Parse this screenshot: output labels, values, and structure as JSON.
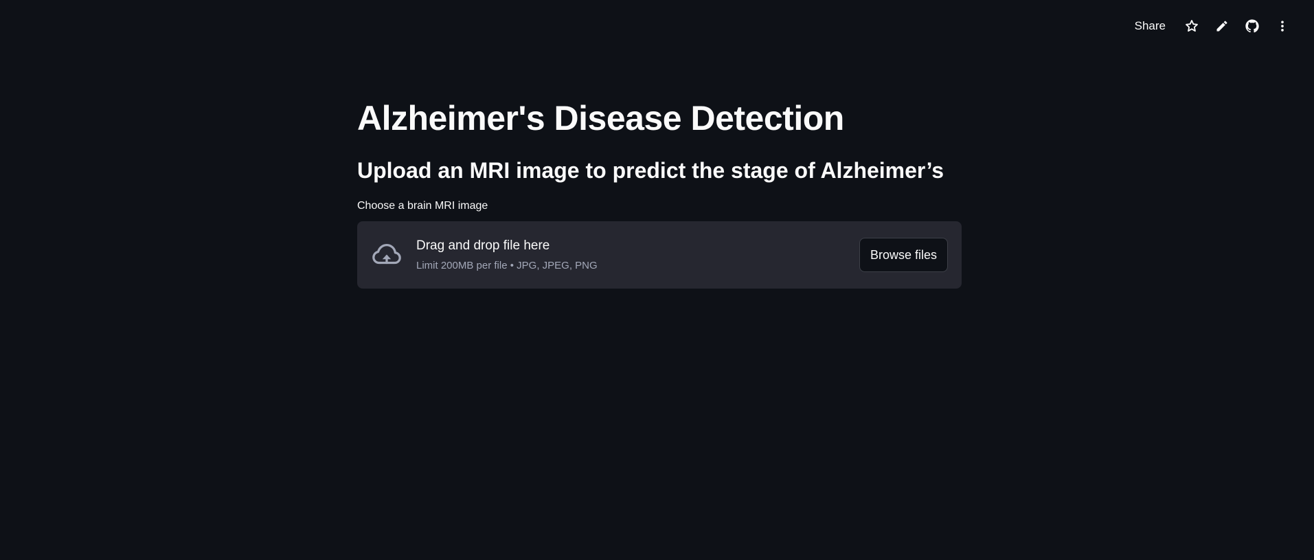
{
  "toolbar": {
    "share_label": "Share",
    "icons": [
      "star-icon",
      "pencil-icon",
      "github-icon",
      "more-vertical-icon"
    ]
  },
  "main": {
    "title": "Alzheimer's Disease Detection",
    "subtitle": "Upload an MRI image to predict the stage of Alzheimer’s",
    "uploader": {
      "label": "Choose a brain MRI image",
      "drop_text": "Drag and drop file here",
      "limit_text": "Limit 200MB per file • JPG, JPEG, PNG",
      "browse_label": "Browse files",
      "icon": "cloud-upload-icon"
    }
  },
  "colors": {
    "background": "#0e1117",
    "surface": "#262730",
    "text": "#fafafa",
    "muted_text": "#a3a8b8",
    "border": "#3d4048"
  }
}
